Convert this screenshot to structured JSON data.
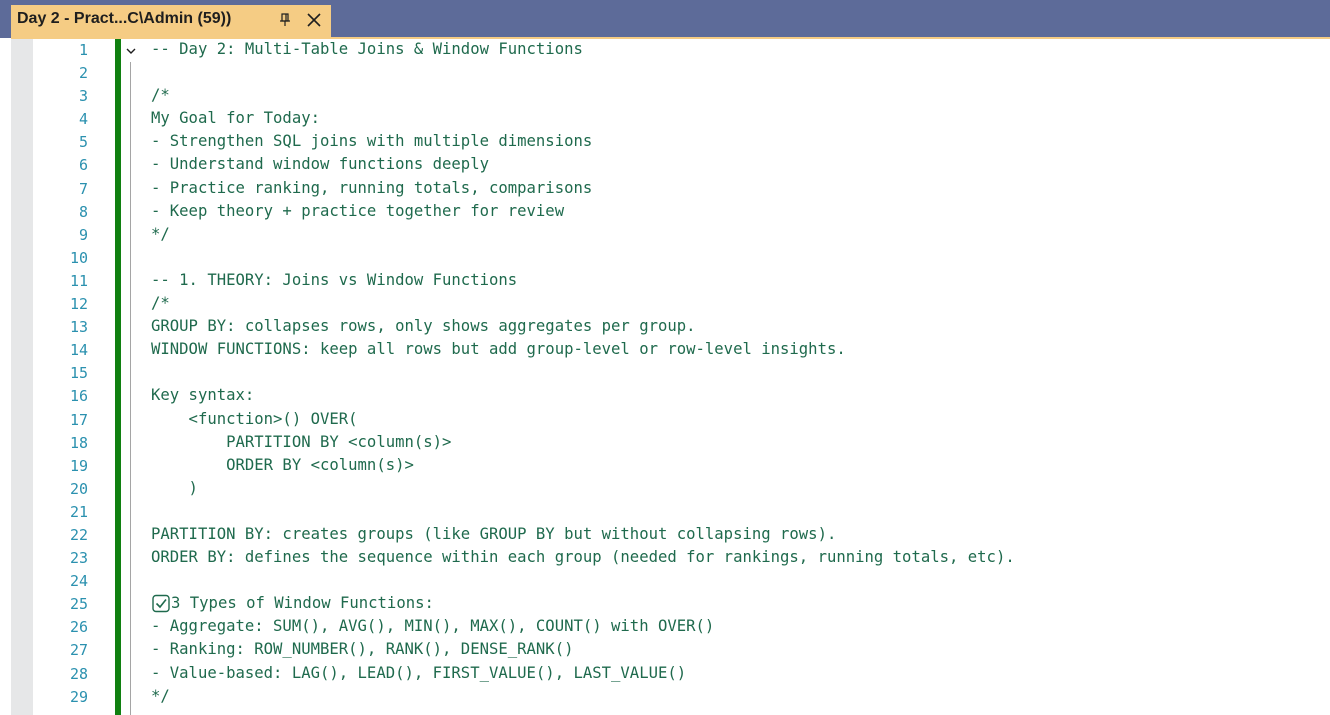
{
  "tab": {
    "title": "Day 2 - Pract...C\\Admin (59))",
    "pin_icon": "pin-icon",
    "close_icon": "close-icon"
  },
  "colors": {
    "tab_bar": "#5d6b99",
    "active_tab": "#f5cc84",
    "line_number": "#2b91af",
    "comment_text": "#1f6a4d",
    "change_marker": "#108010"
  },
  "editor": {
    "lines": [
      {
        "num": "1",
        "text": "-- Day 2: Multi-Table Joins & Window Functions"
      },
      {
        "num": "2",
        "text": ""
      },
      {
        "num": "3",
        "text": "/*"
      },
      {
        "num": "4",
        "text": "My Goal for Today:"
      },
      {
        "num": "5",
        "text": "- Strengthen SQL joins with multiple dimensions"
      },
      {
        "num": "6",
        "text": "- Understand window functions deeply"
      },
      {
        "num": "7",
        "text": "- Practice ranking, running totals, comparisons"
      },
      {
        "num": "8",
        "text": "- Keep theory + practice together for review"
      },
      {
        "num": "9",
        "text": "*/"
      },
      {
        "num": "10",
        "text": ""
      },
      {
        "num": "11",
        "text": "-- 1. THEORY: Joins vs Window Functions"
      },
      {
        "num": "12",
        "text": "/*"
      },
      {
        "num": "13",
        "text": "GROUP BY: collapses rows, only shows aggregates per group."
      },
      {
        "num": "14",
        "text": "WINDOW FUNCTIONS: keep all rows but add group-level or row-level insights."
      },
      {
        "num": "15",
        "text": ""
      },
      {
        "num": "16",
        "text": "Key syntax:"
      },
      {
        "num": "17",
        "text": "    <function>() OVER("
      },
      {
        "num": "18",
        "text": "        PARTITION BY <column(s)>"
      },
      {
        "num": "19",
        "text": "        ORDER BY <column(s)>"
      },
      {
        "num": "20",
        "text": "    )"
      },
      {
        "num": "21",
        "text": ""
      },
      {
        "num": "22",
        "text": "PARTITION BY: creates groups (like GROUP BY but without collapsing rows)."
      },
      {
        "num": "23",
        "text": "ORDER BY: defines the sequence within each group (needed for rankings, running totals, etc)."
      },
      {
        "num": "24",
        "text": ""
      },
      {
        "num": "25",
        "text": "3 Types of Window Functions:",
        "icon": "check-box-icon"
      },
      {
        "num": "26",
        "text": "- Aggregate: SUM(), AVG(), MIN(), MAX(), COUNT() with OVER()"
      },
      {
        "num": "27",
        "text": "- Ranking: ROW_NUMBER(), RANK(), DENSE_RANK()"
      },
      {
        "num": "28",
        "text": "- Value-based: LAG(), LEAD(), FIRST_VALUE(), LAST_VALUE()"
      },
      {
        "num": "29",
        "text": "*/"
      }
    ]
  }
}
